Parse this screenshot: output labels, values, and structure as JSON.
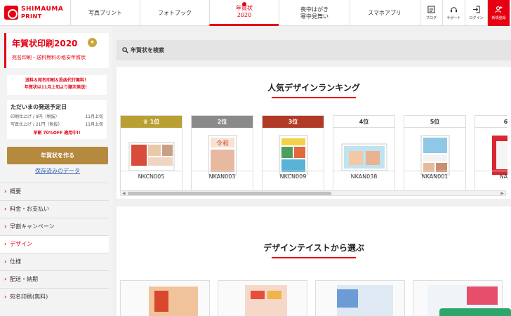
{
  "header": {
    "logo_line1": "SHIMAUMA",
    "logo_line2": "PRINT",
    "nav": [
      {
        "label": "写真プリント"
      },
      {
        "label": "フォトブック"
      },
      {
        "label": "年賀状\n2020"
      },
      {
        "label": "喪中はがき\n寒中見舞い"
      },
      {
        "label": "スマホアプリ"
      }
    ],
    "icons": [
      {
        "label": "ブログ",
        "icon": "blog-icon"
      },
      {
        "label": "サポート",
        "icon": "support-icon"
      },
      {
        "label": "ログイン",
        "icon": "login-icon"
      },
      {
        "label": "新規登録",
        "icon": "register-icon"
      }
    ]
  },
  "sidebar": {
    "title": "年賀状印刷2020",
    "title_badge": "★",
    "subtitle": "宛名印刷・送料無料の格安年賀状",
    "free_line1": "送料＆宛名印刷＆投函代行無料！",
    "free_line2": "年賀状は11月上旬より順次発送！",
    "ship_title": "ただいまの発送予定日",
    "ship_rows": [
      {
        "label": "印刷仕上げ / 9円（税抜）",
        "date": "11月上旬"
      },
      {
        "label": "写真仕上げ / 21円（税抜）",
        "date": "11月上旬"
      }
    ],
    "ship_note": "早割 70%OFF 適用中!!",
    "make_button": "年賀状を作る",
    "saved_link": "保存済みのデータ",
    "menu": [
      {
        "label": "概要"
      },
      {
        "label": "料金・お支払い"
      },
      {
        "label": "早割キャンペーン"
      },
      {
        "label": "デザイン"
      },
      {
        "label": "仕様"
      },
      {
        "label": "配送・納期"
      },
      {
        "label": "宛名印刷(無料)"
      }
    ]
  },
  "main": {
    "search_label": "年賀状を検索",
    "ranking_title": "人気デザインランキング",
    "ranking": [
      {
        "rank": "1位",
        "code": "NKCN005"
      },
      {
        "rank": "2位",
        "code": "NKAN003"
      },
      {
        "rank": "3位",
        "code": "NKCN009"
      },
      {
        "rank": "4位",
        "code": "NKAN038"
      },
      {
        "rank": "5位",
        "code": "NKAN001"
      },
      {
        "rank": "6",
        "code": "NAO"
      }
    ],
    "taste_title": "デザインテイストから選ぶ"
  },
  "colors": {
    "accent": "#e60012",
    "gold": "#b9a034",
    "silver": "#8a8a8a",
    "bronze": "#b13a27",
    "button_gold": "#b58a3e"
  }
}
